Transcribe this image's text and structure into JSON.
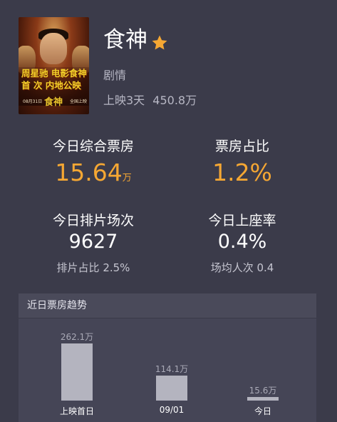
{
  "movie": {
    "title": "食神",
    "genre": "剧情",
    "days_released": "上映3天",
    "total_box_office": "450.8万",
    "poster": {
      "line1": "周星驰 电影食神",
      "line2": "首 次 内地公映",
      "date": "08月31日",
      "logo": "食神",
      "release": "全国上映"
    }
  },
  "metrics": {
    "box_office_label": "今日综合票房",
    "box_office_value": "15.64",
    "box_office_unit": "万",
    "share_label": "票房占比",
    "share_value": "1.2%",
    "screenings_label": "今日排片场次",
    "screenings_value": "9627",
    "screenings_sub": "排片占比 2.5%",
    "occupancy_label": "今日上座率",
    "occupancy_value": "0.4%",
    "occupancy_sub": "场均人次 0.4"
  },
  "trend": {
    "title": "近日票房趋势"
  },
  "chart_data": {
    "type": "bar",
    "categories": [
      "上映首日",
      "09/01",
      "今日"
    ],
    "values": [
      262.1,
      114.1,
      15.6
    ],
    "value_labels": [
      "262.1万",
      "114.1万",
      "15.6万"
    ],
    "color": "#b4b4bf"
  },
  "colors": {
    "background": "#3b3b4a",
    "accent": "#f5a733",
    "star": "#f5a733"
  }
}
